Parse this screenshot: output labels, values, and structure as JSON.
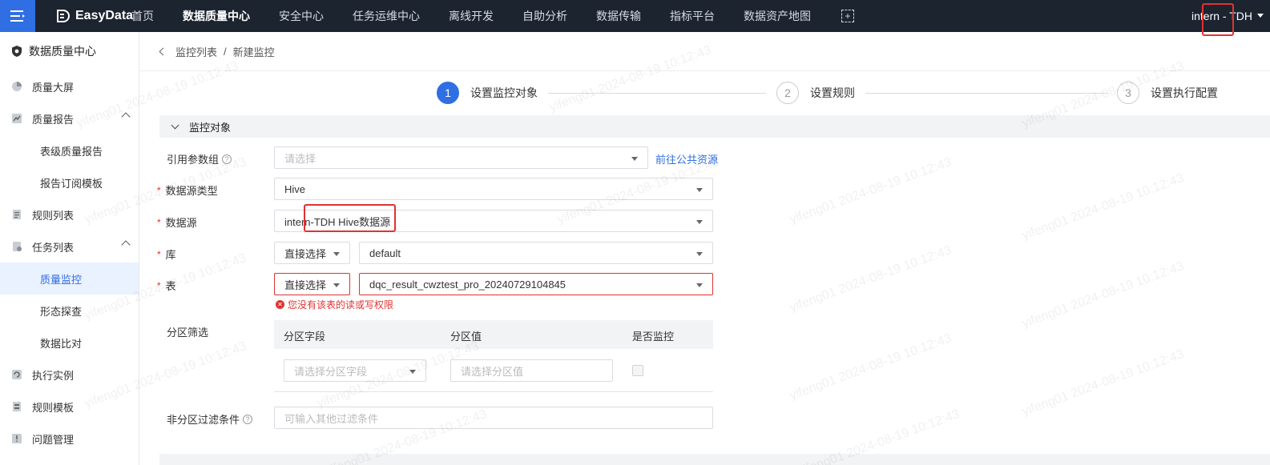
{
  "topbar": {
    "brand": "EasyData",
    "nav": [
      "首页",
      "数据质量中心",
      "安全中心",
      "任务运维中心",
      "离线开发",
      "自助分析",
      "数据传输",
      "指标平台",
      "数据资产地图"
    ],
    "active_nav": "数据质量中心",
    "user": "intern - TDH"
  },
  "sidebar": {
    "title": "数据质量中心",
    "items": [
      {
        "label": "质量大屏",
        "icon": "pie-chart-icon"
      },
      {
        "label": "质量报告",
        "icon": "report-icon"
      },
      {
        "label": "表级质量报告"
      },
      {
        "label": "报告订阅模板"
      },
      {
        "label": "规则列表",
        "icon": "list-icon"
      },
      {
        "label": "任务列表",
        "icon": "task-icon"
      },
      {
        "label": "质量监控"
      },
      {
        "label": "形态探查"
      },
      {
        "label": "数据比对"
      },
      {
        "label": "执行实例",
        "icon": "instance-icon"
      },
      {
        "label": "规则模板",
        "icon": "template-icon"
      },
      {
        "label": "问题管理",
        "icon": "issue-icon"
      }
    ]
  },
  "breadcrumb": {
    "parent": "监控列表",
    "sep": "/",
    "current": "新建监控"
  },
  "steps": [
    {
      "num": "1",
      "label": "设置监控对象"
    },
    {
      "num": "2",
      "label": "设置规则"
    },
    {
      "num": "3",
      "label": "设置执行配置"
    }
  ],
  "section": {
    "title": "监控对象"
  },
  "form": {
    "param_group": {
      "label": "引用参数组",
      "placeholder": "请选择",
      "link": "前往公共资源"
    },
    "ds_type": {
      "label": "数据源类型",
      "value": "Hive"
    },
    "ds": {
      "label": "数据源",
      "value": "intern-TDH Hive数据源"
    },
    "db": {
      "label": "库",
      "mode": "直接选择",
      "value": "default"
    },
    "table": {
      "label": "表",
      "mode": "直接选择",
      "value": "dqc_result_cwztest_pro_20240729104845",
      "error": "您没有该表的读或写权限"
    },
    "partition": {
      "label": "分区筛选",
      "headers": [
        "分区字段",
        "分区值",
        "是否监控"
      ],
      "field_placeholder": "请选择分区字段",
      "value_placeholder": "请选择分区值"
    },
    "filter": {
      "label": "非分区过滤条件",
      "placeholder": "可输入其他过滤条件"
    }
  },
  "watermark": "yifeng01 2024-08-19 10:12:43"
}
